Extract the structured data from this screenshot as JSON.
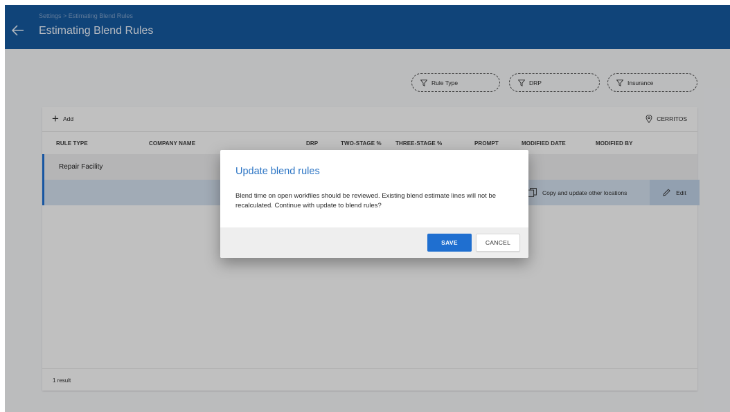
{
  "header": {
    "breadcrumb": "Settings > Estimating Blend Rules",
    "title": "Estimating Blend Rules",
    "back_icon": "arrow-left-icon"
  },
  "filters": [
    {
      "label": "Rule Type",
      "icon": "filter-icon"
    },
    {
      "label": "DRP",
      "icon": "filter-icon"
    },
    {
      "label": "Insurance",
      "icon": "filter-icon"
    }
  ],
  "toolbar": {
    "add_label": "Add",
    "location_label": "CERRITOS",
    "location_icon": "location-pin-icon"
  },
  "table": {
    "columns": [
      "RULE TYPE",
      "COMPANY NAME",
      "DRP",
      "TWO-STAGE %",
      "THREE-STAGE %",
      "PROMPT",
      "MODIFIED DATE",
      "MODIFIED BY"
    ],
    "group_row": {
      "label": "Repair Facility"
    },
    "selected_row": {
      "copy_label": "Copy and update other locations",
      "edit_label": "Edit"
    }
  },
  "footer": {
    "result_count": "1 result"
  },
  "dialog": {
    "title": "Update blend rules",
    "body": "Blend time on open workfiles should be reviewed. Existing blend estimate lines will not be recalculated. Continue with update to blend rules?",
    "save_label": "SAVE",
    "cancel_label": "CANCEL"
  },
  "colors": {
    "header": "#15589c",
    "accent": "#1f6fd0",
    "dialog_title": "#2b74c4"
  }
}
